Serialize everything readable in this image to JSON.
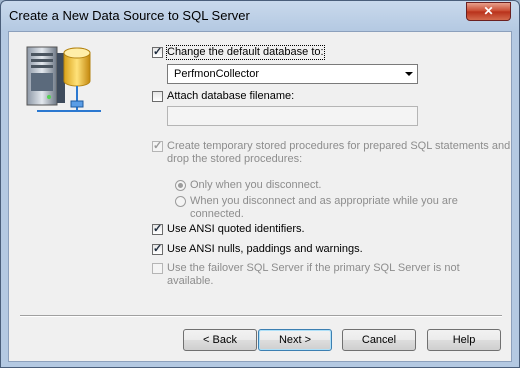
{
  "window": {
    "title": "Create a New Data Source to SQL Server",
    "close_label": "✕"
  },
  "options": {
    "change_db": {
      "label": "Change the default database to:",
      "checked": true
    },
    "database_value": "PerfmonCollector",
    "attach_db": {
      "label": "Attach database filename:",
      "checked": false
    },
    "attach_value": "",
    "temp_procs": {
      "label_line1": "Create temporary stored procedures for prepared SQL statements and",
      "label_line2": "drop the stored procedures:",
      "checked": true,
      "enabled": false
    },
    "radio_disconnect": {
      "label": "Only when you disconnect.",
      "checked": true
    },
    "radio_appropriate": {
      "label_line1": "When you disconnect and as appropriate while you are",
      "label_line2": "connected.",
      "checked": false
    },
    "ansi_quoted": {
      "label": "Use ANSI quoted identifiers.",
      "checked": true
    },
    "ansi_nulls": {
      "label": "Use ANSI nulls, paddings and warnings.",
      "checked": true
    },
    "failover": {
      "label_line1": "Use the failover SQL Server if the primary SQL Server is not",
      "label_line2": "available.",
      "checked": false,
      "enabled": false
    }
  },
  "buttons": {
    "back": "< Back",
    "next": "Next >",
    "cancel": "Cancel",
    "help": "Help"
  }
}
